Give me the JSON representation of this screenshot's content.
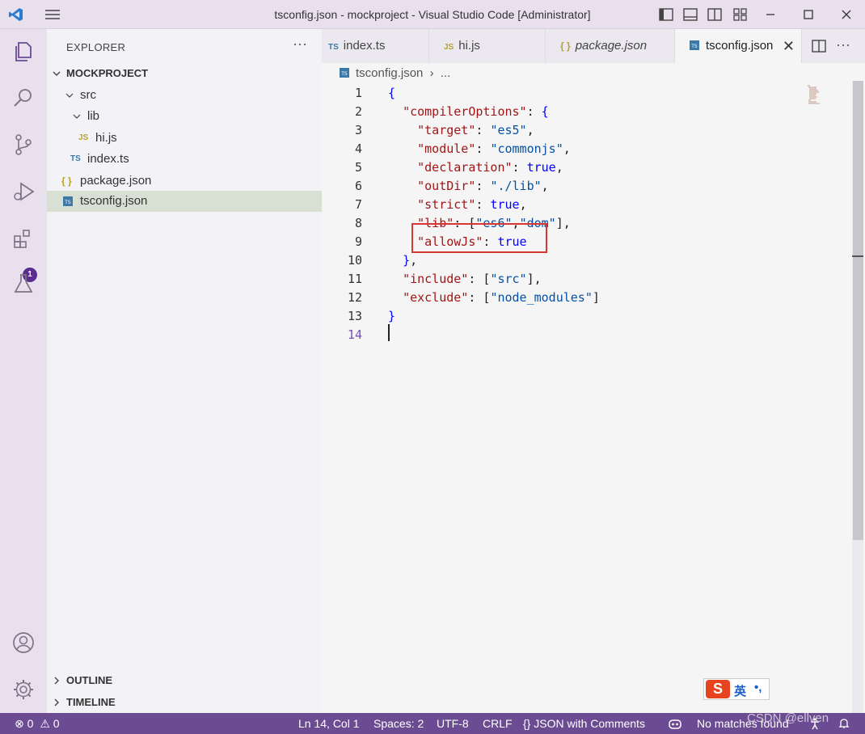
{
  "window": {
    "title": "tsconfig.json - mockproject - Visual Studio Code [Administrator]"
  },
  "sidebar": {
    "header": "EXPLORER",
    "more": "···",
    "project": "MOCKPROJECT",
    "tree": [
      {
        "label": "src"
      },
      {
        "label": "lib"
      },
      {
        "label": "hi.js",
        "badge": "JS"
      },
      {
        "label": "index.ts",
        "badge": "TS"
      },
      {
        "label": "package.json",
        "badge": "{ }"
      },
      {
        "label": "tsconfig.json",
        "badge": "TS"
      }
    ],
    "sections": [
      "OUTLINE",
      "TIMELINE"
    ]
  },
  "activity": {
    "extensions_badge": "1"
  },
  "tabs": [
    {
      "label": "index.ts",
      "badge": "TS"
    },
    {
      "label": "hi.js",
      "badge": "JS"
    },
    {
      "label": "package.json",
      "badge": "{ }"
    },
    {
      "label": "tsconfig.json",
      "badge": "TS",
      "close": "✕"
    }
  ],
  "breadcrumb": {
    "file": "tsconfig.json",
    "sep": "›",
    "rest": "..."
  },
  "code": {
    "line_numbers": [
      "1",
      "2",
      "3",
      "4",
      "5",
      "6",
      "7",
      "8",
      "9",
      "10",
      "11",
      "12",
      "13",
      "14"
    ]
  },
  "status": {
    "errors": "0",
    "warnings": "0",
    "position": "Ln 14, Col 1",
    "spaces": "Spaces: 2",
    "encoding": "UTF-8",
    "eol": "CRLF",
    "language": "JSON with Comments",
    "matches": "No matches found"
  },
  "ime": {
    "logo": "S",
    "lang": "英",
    "punct": "•,"
  },
  "watermark": "CSDN @ellven",
  "colors": {
    "status_bar": "#6b4b92",
    "highlight_box": "#d83535",
    "current_line": "#e3f1dc"
  }
}
